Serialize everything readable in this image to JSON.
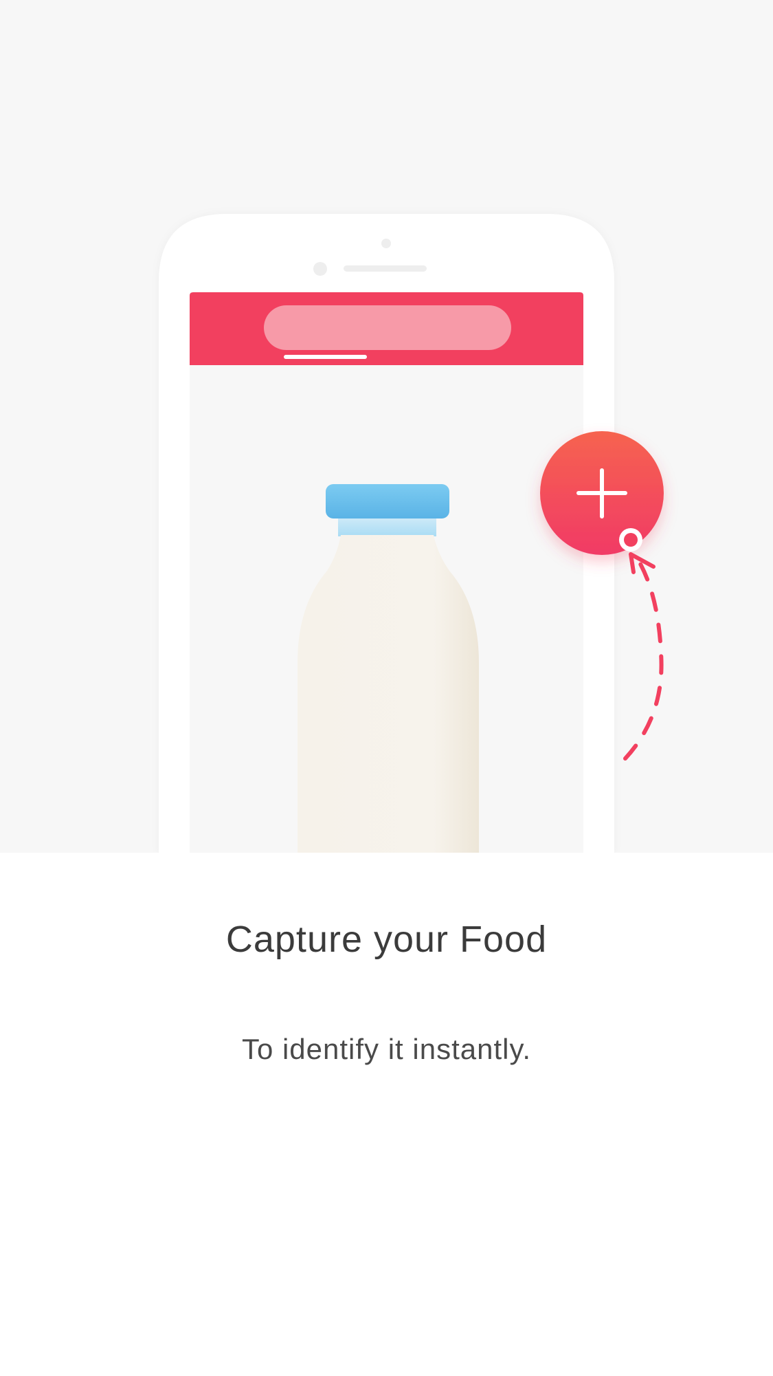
{
  "onboarding": {
    "title": "Capture your Food",
    "subtitle": "To identify it instantly."
  },
  "illustration": {
    "icons": {
      "phone": "phone-mockup-icon",
      "bottle": "milk-bottle-icon",
      "add": "plus-icon",
      "arrow": "dashed-arrow-icon"
    }
  },
  "colors": {
    "accent": "#f2405f",
    "accent_light": "#f6606a",
    "search_pill": "#f79aa8",
    "bottle_cap": "#6ec1ec",
    "bottle_body": "#f6f2ea",
    "background_top": "#f7f7f7",
    "background_bottom": "#ffffff",
    "text": "#3b3b3b"
  }
}
